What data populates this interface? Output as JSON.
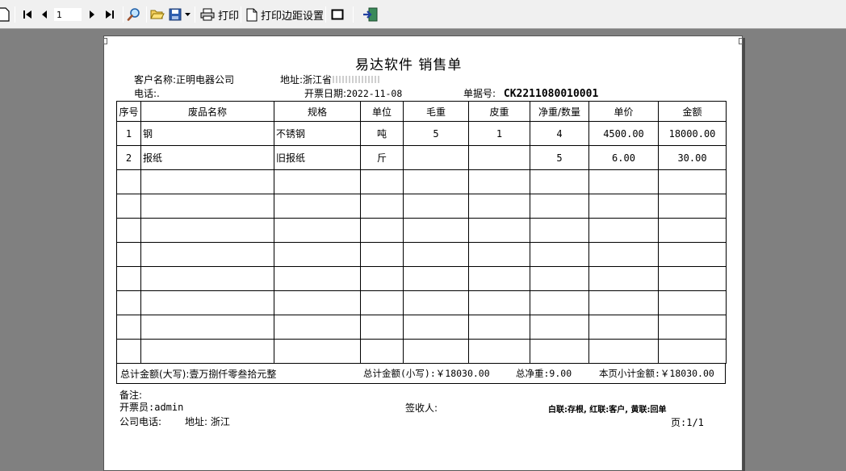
{
  "toolbar": {
    "page_value": "1",
    "print_label": "打印",
    "margin_label": "打印边距设置"
  },
  "doc": {
    "title": "易达软件 销售单",
    "customer_label": "客户名称:",
    "customer_name": "正明电器公司",
    "address_label": "地址:",
    "address_value": "浙江省",
    "phone_label": "电话:",
    "phone_value": ".",
    "date_label": "开票日期:",
    "date_value": "2022-11-08",
    "docno_label": "单据号:",
    "docno_value": "CK2211080010001",
    "columns": [
      "序号",
      "废品名称",
      "规格",
      "单位",
      "毛重",
      "皮重",
      "净重/数量",
      "单价",
      "金额"
    ],
    "rows": [
      {
        "no": "1",
        "name": "钢",
        "spec": "不锈钢",
        "unit": "吨",
        "gross": "5",
        "tare": "1",
        "net": "4",
        "price": "4500.00",
        "amount": "18000.00"
      },
      {
        "no": "2",
        "name": "报纸",
        "spec": "旧报纸",
        "unit": "斤",
        "gross": "",
        "tare": "",
        "net": "5",
        "price": "6.00",
        "amount": "30.00"
      }
    ],
    "empty_rows": 8,
    "total_upper": "总计金额(大写):壹万捌仟零叁拾元整",
    "total_lower": "总计金额(小写):￥18030.00",
    "total_net": "总净重:9.00",
    "page_subtotal": "本页小计金额:￥18030.00",
    "remarks_label": "备注:",
    "issuer": "开票员:admin",
    "receiver_label": "签收人:",
    "copy_legend": "白联:存根, 红联:客户, 黄联:回单",
    "company_phone_label": "公司电话:",
    "company_address": "地址: 浙江",
    "page_indicator": "页:1/1"
  }
}
